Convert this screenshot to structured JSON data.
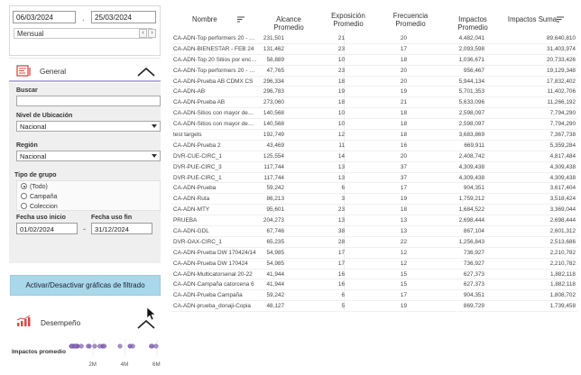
{
  "dates": {
    "start": "06/03/2024",
    "end": "25/03/2024",
    "separator": "."
  },
  "period": {
    "value": "Mensual",
    "prev": "‹",
    "next": "›"
  },
  "general": {
    "title": "General",
    "icon": "report-icon"
  },
  "filters": {
    "buscar_label": "Buscar",
    "nivel_label": "Nivel de Ubicación",
    "nivel_value": "Nacional",
    "region_label": "Región",
    "region_value": "Nacional",
    "tipo_label": "Tipo de grupo",
    "tipo_options": [
      "(Todo)",
      "Campaña",
      "Coleccion"
    ],
    "fecha_inicio_label": "Fecha uso inicio",
    "fecha_inicio": "01/02/2024",
    "fecha_sep": "-",
    "fecha_fin_label": "Fecha uso fin",
    "fecha_fin": "31/12/2024"
  },
  "toggle_label": "Activar/Desactivar gráficas de filtrado",
  "desempeno": {
    "title": "Desempeño",
    "icon": "bar-chart-trend-icon"
  },
  "chart_data": {
    "type": "scatter",
    "ylabel": "Impactos promedio",
    "tick_labels": [
      "2M",
      "4M",
      "6M"
    ],
    "ticks": [
      2000000,
      4000000,
      6000000
    ],
    "xlim": [
      0,
      6000000
    ],
    "marker_color": "#8b6bb8",
    "values": [
      231501,
      131462,
      58889,
      47765,
      296334,
      296783,
      273060,
      140568,
      140568,
      192749,
      43469,
      125554,
      117744,
      117744,
      59242,
      86213,
      95601,
      204273,
      67746,
      65235,
      54985,
      54985,
      41944,
      41944,
      59242,
      48127
    ]
  },
  "table": {
    "headers": {
      "name": "Nombre",
      "alcance": "Alcance Promedio",
      "exposicion": "Exposición Promedio",
      "frecuencia": "Frecuencia Promedio",
      "impactos": "Impactos Promedio",
      "suma": "Impactos Suma"
    },
    "rows": [
      [
        "CA-ADN-Top performers 20 - Alcanc...",
        "231,501",
        "21",
        "20",
        "4,482,041",
        "89,640,810"
      ],
      [
        "CA-ADN-BIENESTAR - FEB 24",
        "131,462",
        "23",
        "17",
        "2,093,598",
        "31,403,974"
      ],
      [
        "CA-ADN-Top 20 Sitios por encima m...",
        "58,889",
        "10",
        "18",
        "1,036,671",
        "20,733,426"
      ],
      [
        "CA-ADN-Top performers 20 - Frecu...",
        "47,765",
        "23",
        "20",
        "956,467",
        "19,129,348"
      ],
      [
        "CA-ADN-Prueba AB CDMX CS",
        "296,334",
        "18",
        "20",
        "5,944,134",
        "17,832,402"
      ],
      [
        "CA-ADN-AB",
        "296,783",
        "19",
        "19",
        "5,701,353",
        "11,402,706"
      ],
      [
        "CA-ADN-Prueba AB",
        "273,060",
        "18",
        "21",
        "5,633,096",
        "11,266,192"
      ],
      [
        "CA-ADN-Sitios con mayor demanda...",
        "140,568",
        "10",
        "18",
        "2,598,097",
        "7,794,290"
      ],
      [
        "CA-ADN-Sitios con mayor demanda...",
        "140,568",
        "10",
        "18",
        "2,598,097",
        "7,794,290"
      ],
      [
        "test targets",
        "192,749",
        "12",
        "18",
        "3,683,869",
        "7,367,738"
      ],
      [
        "CA-ADN-Prueba 2",
        "43,469",
        "11",
        "16",
        "669,911",
        "5,359,284"
      ],
      [
        "DVR-CUE-CIRC_1",
        "125,554",
        "14",
        "20",
        "2,408,742",
        "4,817,484"
      ],
      [
        "DVR-PUE-CIRC_3",
        "117,744",
        "13",
        "37",
        "4,309,438",
        "4,309,438"
      ],
      [
        "DVR-PUE-CIRC_1",
        "117,744",
        "13",
        "37",
        "4,309,438",
        "4,309,438"
      ],
      [
        "CA-ADN-Prueba",
        "59,242",
        "6",
        "17",
        "904,351",
        "3,617,404"
      ],
      [
        "CA-ADN-Ruta",
        "86,213",
        "3",
        "19",
        "1,759,212",
        "3,518,424"
      ],
      [
        "CA-ADN-MTY",
        "95,601",
        "23",
        "18",
        "1,684,522",
        "3,369,044"
      ],
      [
        "PRUEBA",
        "204,273",
        "13",
        "13",
        "2,698,444",
        "2,698,444"
      ],
      [
        "CA-ADN-GDL",
        "67,746",
        "38",
        "13",
        "867,104",
        "2,601,312"
      ],
      [
        "DVR-OAX-CIRC_1",
        "65,235",
        "28",
        "22",
        "1,256,843",
        "2,513,686"
      ],
      [
        "CA-ADN-Prueba DW 170424/14",
        "54,985",
        "17",
        "12",
        "736,927",
        "2,210,782"
      ],
      [
        "CA-ADN-Prueba DW 170424",
        "54,985",
        "17",
        "12",
        "736,927",
        "2,210,782"
      ],
      [
        "CA-ADN-Multicatorsenal 20-22",
        "41,944",
        "16",
        "15",
        "627,373",
        "1,882,118"
      ],
      [
        "CA-ADN-Campaña catorcena 6",
        "41,944",
        "16",
        "15",
        "627,373",
        "1,882,118"
      ],
      [
        "CA-ADN-Prueba Campaña",
        "59,242",
        "6",
        "17",
        "904,351",
        "1,808,702"
      ],
      [
        "CA-ADN-prueba_donaji-Copia",
        "48,127",
        "5",
        "19",
        "869,729",
        "1,739,458"
      ]
    ]
  }
}
